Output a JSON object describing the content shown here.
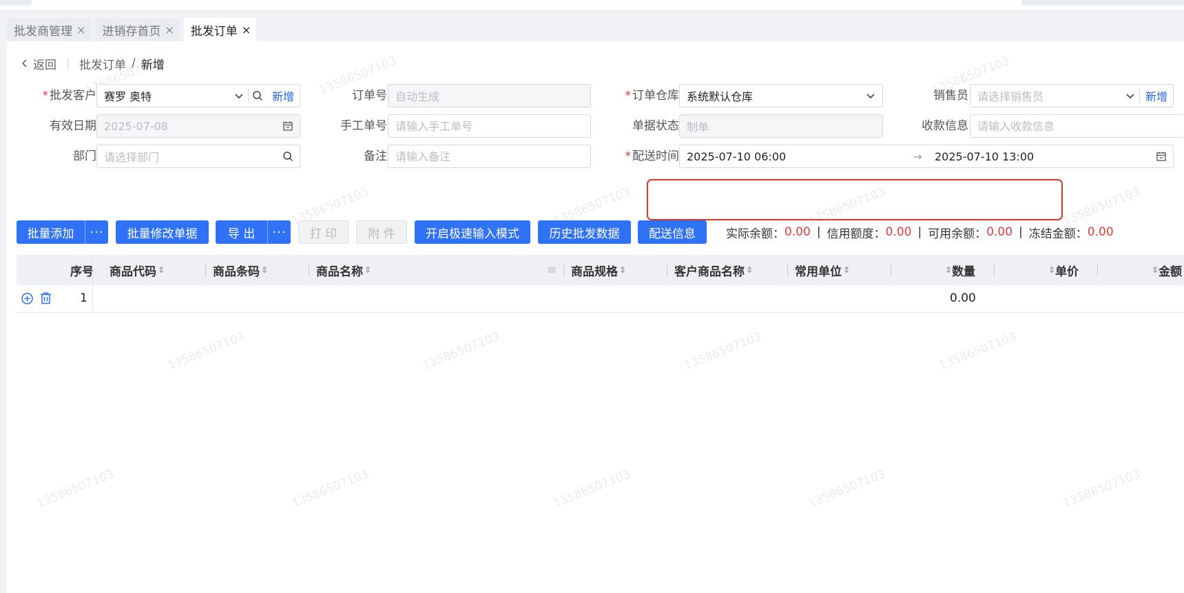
{
  "tabs": [
    {
      "label": "批发商管理",
      "active": false
    },
    {
      "label": "进销存首页",
      "active": false
    },
    {
      "label": "批发订单",
      "active": true
    }
  ],
  "tab_close_glyph": "×",
  "breadcrumb": {
    "back": "返回",
    "parent": "批发订单",
    "separator": "/",
    "current": "新增"
  },
  "form": {
    "customer": {
      "label": "批发客户",
      "value": "赛罗 奥特",
      "add_link": "新增"
    },
    "order_no": {
      "label": "订单号",
      "placeholder": "自动生成"
    },
    "warehouse": {
      "label": "订单仓库",
      "value": "系统默认仓库"
    },
    "salesperson": {
      "label": "销售员",
      "placeholder": "请选择销售员",
      "add_link": "新增"
    },
    "valid_date": {
      "label": "有效日期",
      "value": "2025-07-08"
    },
    "manual_no": {
      "label": "手工单号",
      "placeholder": "请输入手工单号"
    },
    "doc_status": {
      "label": "单据状态",
      "value": "制单"
    },
    "payment_info": {
      "label": "收款信息",
      "placeholder": "请输入收款信息"
    },
    "department": {
      "label": "部门",
      "placeholder": "请选择部门"
    },
    "remark": {
      "label": "备注",
      "placeholder": "请输入备注"
    },
    "delivery_time": {
      "label": "配送时间",
      "start": "2025-07-10 06:00",
      "arrow": "→",
      "end": "2025-07-10 13:00"
    }
  },
  "toolbar": {
    "batch_add": "批量添加",
    "more": "···",
    "batch_modify": "批量修改单据",
    "export": "导 出",
    "print": "打 印",
    "attachment": "附 件",
    "fast_input": "开启极速输入模式",
    "history": "历史批发数据",
    "delivery_info": "配送信息"
  },
  "balances": [
    {
      "label": "实际余额：",
      "value": "0.00"
    },
    {
      "label": "信用额度：",
      "value": "0.00"
    },
    {
      "label": "可用余额：",
      "value": "0.00"
    },
    {
      "label": "冻结金额：",
      "value": "0.00"
    }
  ],
  "balance_separator": "|",
  "table": {
    "columns": [
      "序号",
      "商品代码",
      "商品条码",
      "商品名称",
      "商品规格",
      "客户商品名称",
      "常用单位",
      "数量",
      "单价",
      "金额"
    ],
    "rows": [
      {
        "index": "1",
        "quantity": "0.00"
      }
    ]
  },
  "watermark_text": "13586507103",
  "colors": {
    "primary": "#3072f6",
    "required": "#e23b3b",
    "highlight_border": "#d63a2a"
  }
}
